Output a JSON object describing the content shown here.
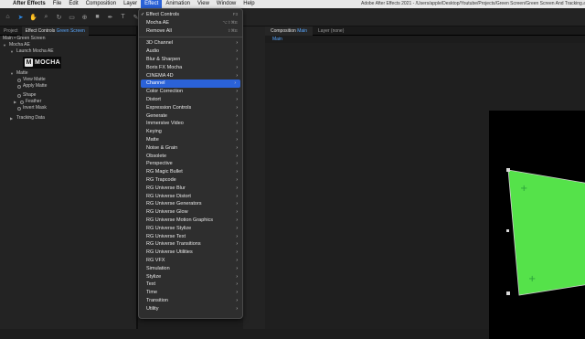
{
  "menubar": {
    "apple_icon": "apple-icon",
    "app_name": "After Effects",
    "items": [
      "File",
      "Edit",
      "Composition",
      "Layer",
      "Effect",
      "Animation",
      "View",
      "Window",
      "Help"
    ],
    "active_item": "Effect",
    "window_title": "Adobe After Effects 2021 - /Users/apple/Desktop/Youtube/Projects/Green Screen/Green Screen And Tracking.aep *"
  },
  "left_panel": {
    "tabs": [
      {
        "label": "Project"
      },
      {
        "label_prefix": "Effect Controls",
        "label_highlight": "Green Screen"
      }
    ],
    "crumb": "Main • Green Screen",
    "effect_name": "Mocha AE",
    "launch": "Launch Mocha AE",
    "mocha_logo_letter": "M",
    "mocha_logo_text": "MOCHA",
    "matte_group": "Matte",
    "view_matte": "View Matte",
    "apply_matte": "Apply Matte",
    "shape": "Shape",
    "feather": "Feather",
    "invert_mask": "Invert Mask",
    "tracking_data": "Tracking Data"
  },
  "comp_panel": {
    "tab_prefix": "Composition",
    "tab_highlight": "Main",
    "layer_tab": "Layer (none)",
    "crumb": "Main"
  },
  "effect_menu": {
    "top_items": [
      {
        "label": "Effect Controls",
        "shortcut": "F3",
        "checked": true
      },
      {
        "label": "Mocha AE",
        "shortcut": "⌥⇧⌘E"
      },
      {
        "label": "Remove All",
        "shortcut": "⇧⌘E"
      }
    ],
    "categories": [
      "3D Channel",
      "Audio",
      "Blur & Sharpen",
      "Boris FX Mocha",
      "CINEMA 4D",
      "Channel",
      "Color Correction",
      "Distort",
      "Expression Controls",
      "Generate",
      "Immersive Video",
      "Keying",
      "Matte",
      "Noise & Grain",
      "Obsolete",
      "Perspective",
      "RG Magic Bullet",
      "RG Trapcode",
      "RG Universe Blur",
      "RG Universe Distort",
      "RG Universe Generators",
      "RG Universe Glow",
      "RG Universe Motion Graphics",
      "RG Universe Stylize",
      "RG Universe Text",
      "RG Universe Transitions",
      "RG Universe Utilities",
      "RG VFX",
      "Simulation",
      "Stylize",
      "Text",
      "Time",
      "Transition",
      "Utility"
    ],
    "highlighted": "Channel",
    "check_glyph": "✓",
    "submenu_arrow": "›"
  },
  "colors": {
    "accent": "#2b62d8",
    "green_screen": "#55e24a",
    "tab_highlight": "#5aa8ff"
  }
}
